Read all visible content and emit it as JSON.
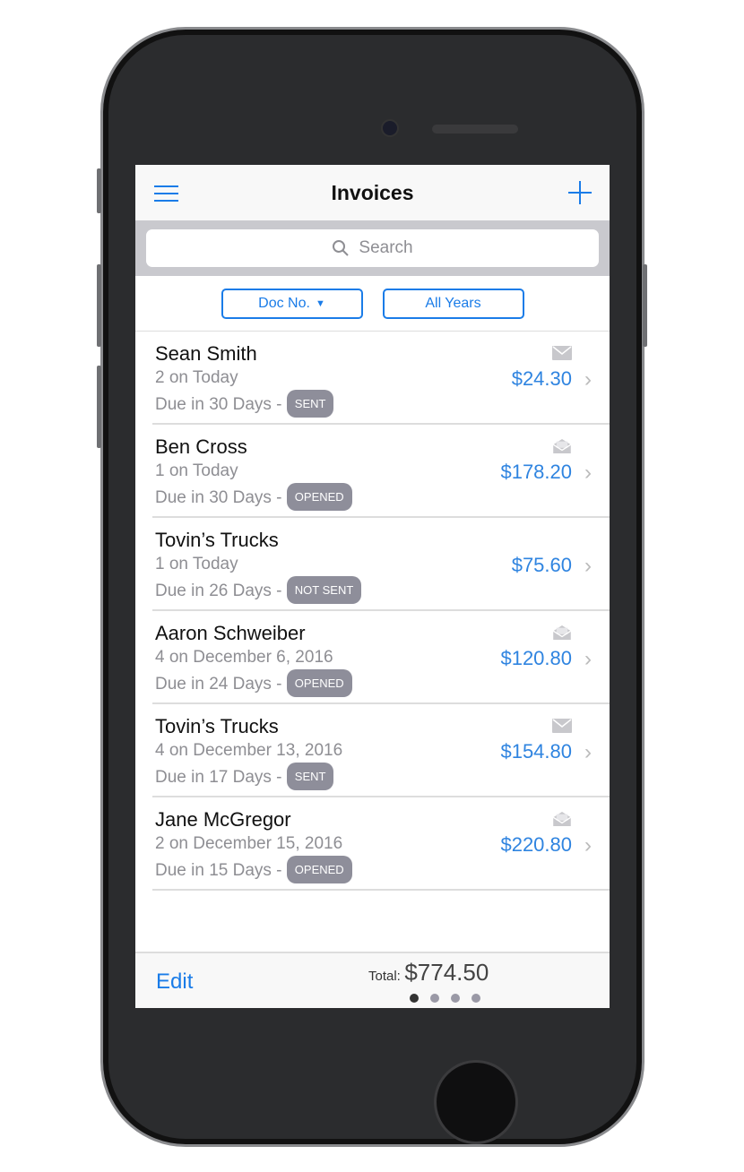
{
  "header": {
    "title": "Invoices",
    "menu_icon": "hamburger-icon",
    "add_icon": "plus-icon"
  },
  "search": {
    "placeholder": "Search"
  },
  "filters": {
    "sort": "Doc No.",
    "year": "All Years"
  },
  "invoices": [
    {
      "name": "Sean Smith",
      "doc": "2 on Today",
      "due": "Due in 30 Days -",
      "status": "SENT",
      "amount": "$24.30",
      "icon": "envelope-closed"
    },
    {
      "name": "Ben Cross",
      "doc": "1 on Today",
      "due": "Due in 30 Days -",
      "status": "OPENED",
      "amount": "$178.20",
      "icon": "envelope-open"
    },
    {
      "name": "Tovin’s Trucks",
      "doc": "1 on Today",
      "due": "Due in 26 Days -",
      "status": "NOT SENT",
      "amount": "$75.60",
      "icon": ""
    },
    {
      "name": "Aaron Schweiber",
      "doc": "4 on December 6, 2016",
      "due": "Due in 24 Days -",
      "status": "OPENED",
      "amount": "$120.80",
      "icon": "envelope-open"
    },
    {
      "name": "Tovin’s Trucks",
      "doc": "4 on December 13, 2016",
      "due": "Due in 17 Days -",
      "status": "SENT",
      "amount": "$154.80",
      "icon": "envelope-closed"
    },
    {
      "name": "Jane McGregor",
      "doc": "2 on December 15, 2016",
      "due": "Due in 15 Days -",
      "status": "OPENED",
      "amount": "$220.80",
      "icon": "envelope-open"
    }
  ],
  "footer": {
    "edit": "Edit",
    "total_label": "Total:",
    "total_value": "$774.50",
    "pages": 4,
    "current_page": 1
  },
  "colors": {
    "accent": "#1a7ce8",
    "amount": "#2f84e0",
    "badge": "#8e8e9a"
  }
}
